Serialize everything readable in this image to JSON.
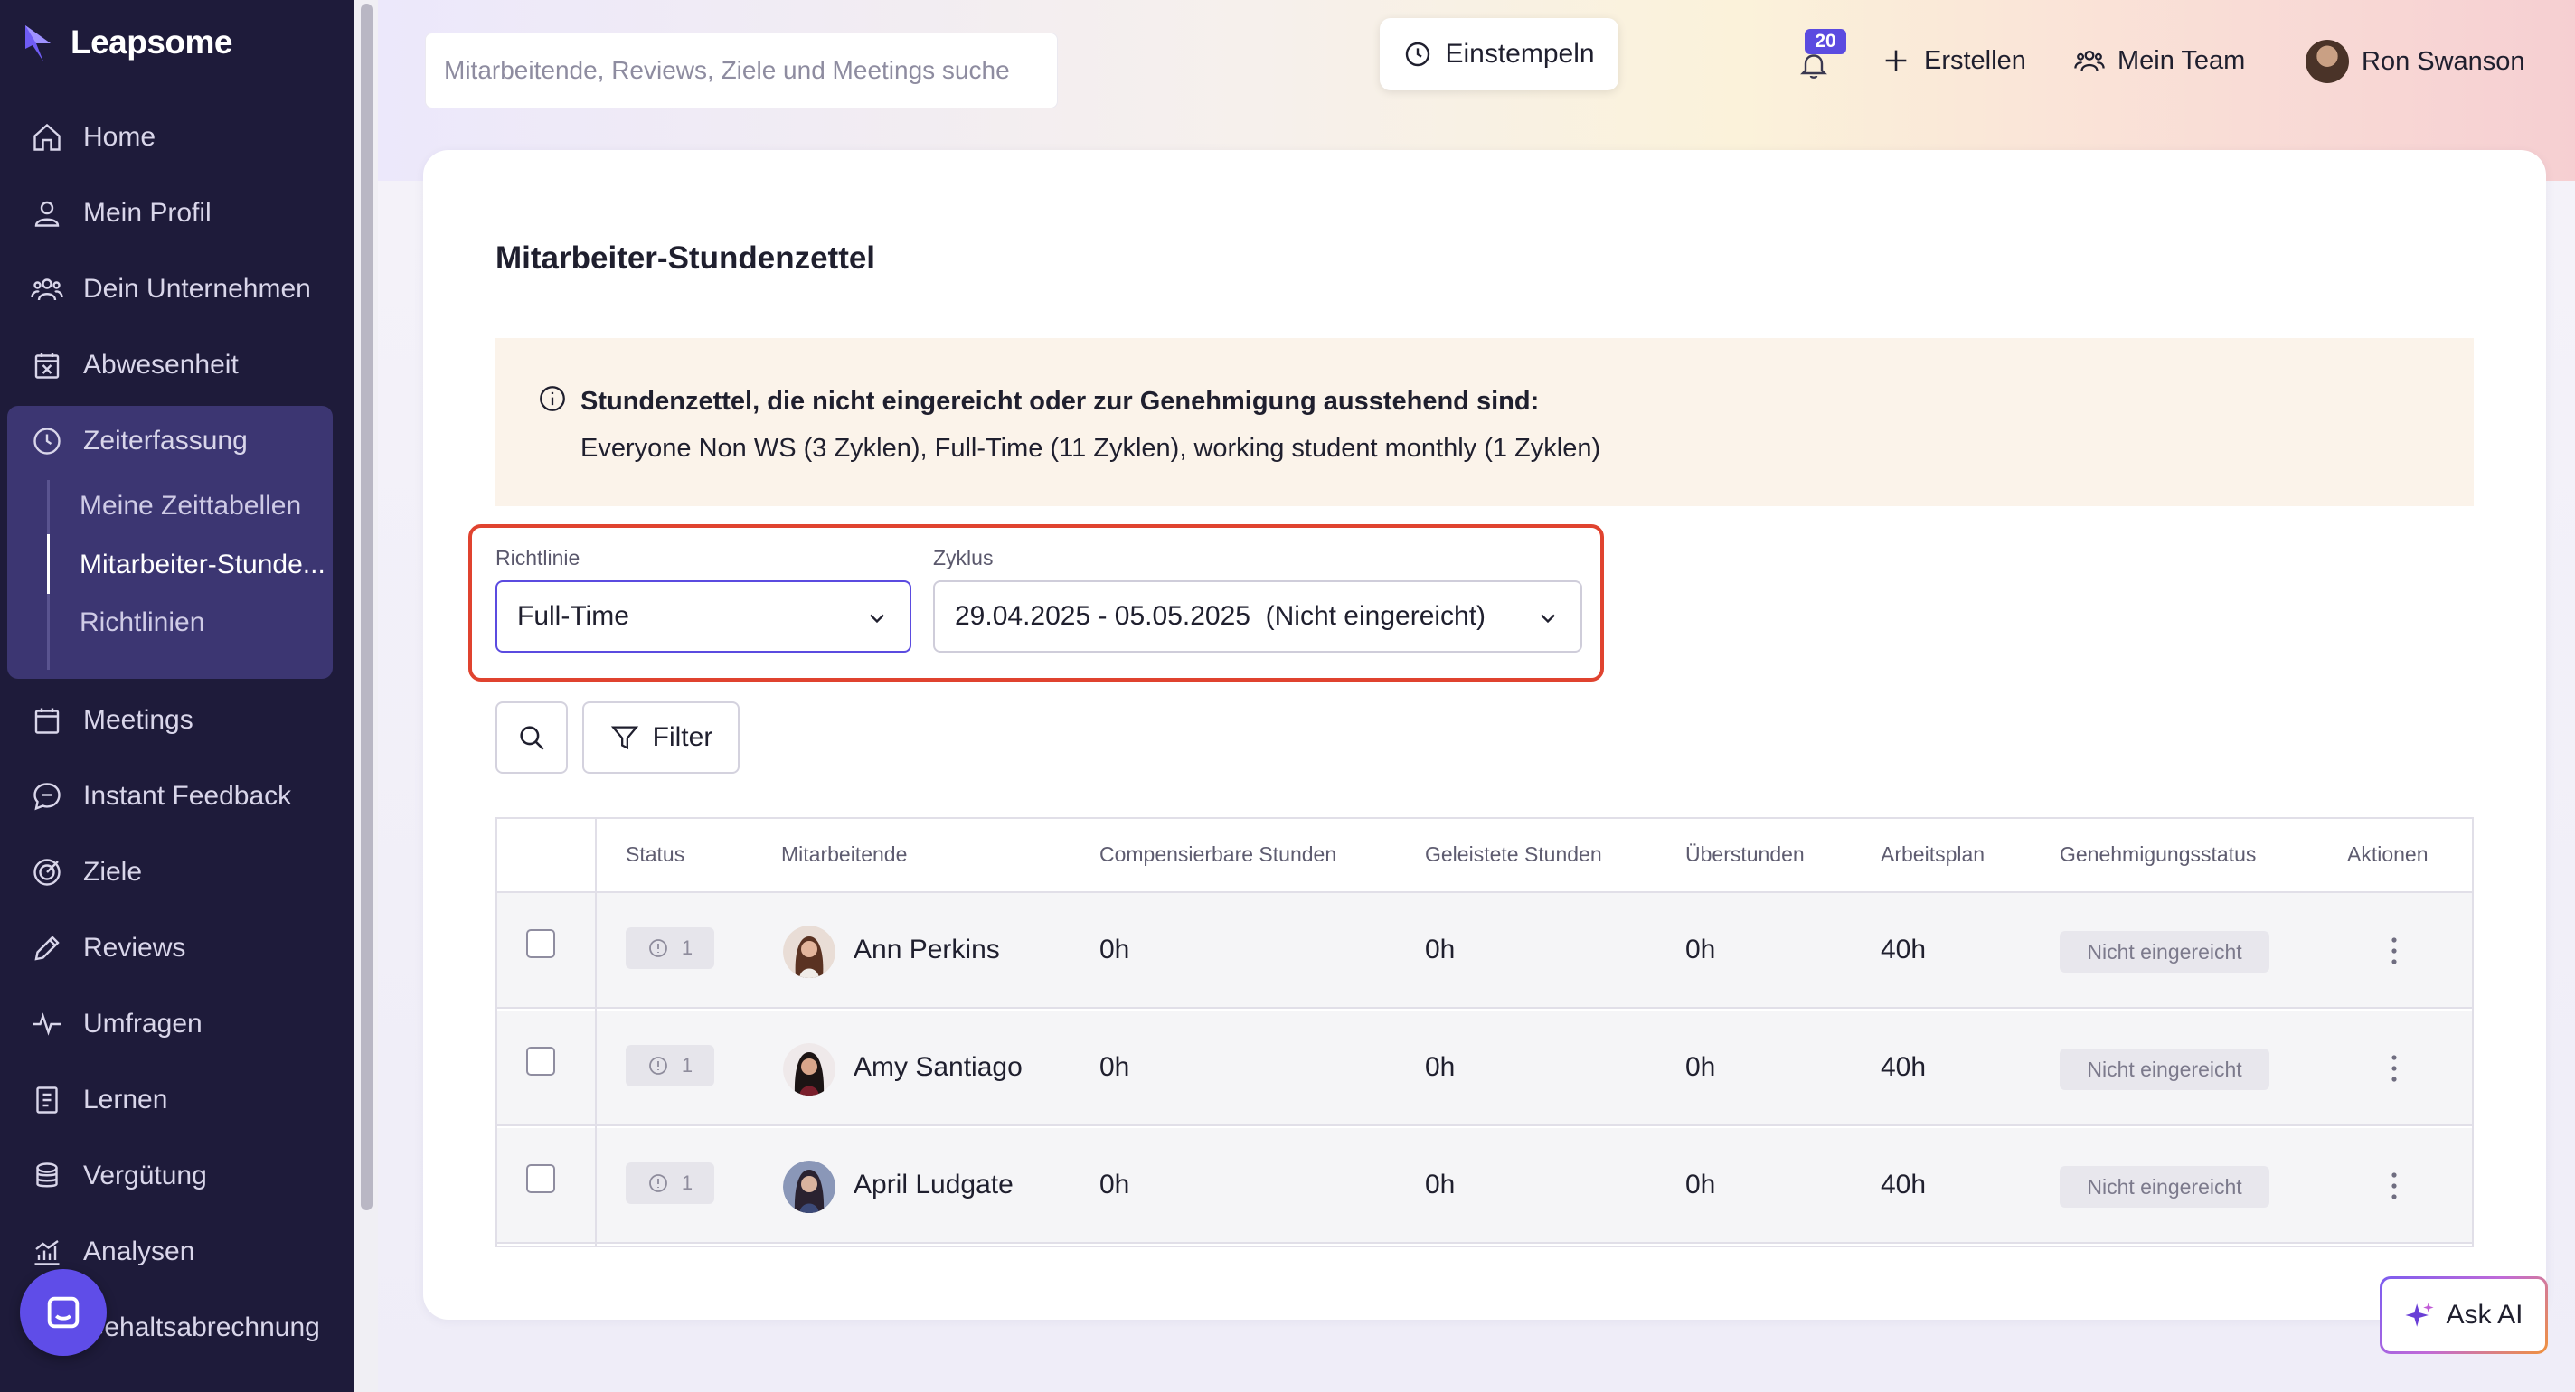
{
  "app": {
    "logo": "Leapsome"
  },
  "sidebar": {
    "items": [
      {
        "label": "Home",
        "icon": "home-icon"
      },
      {
        "label": "Mein Profil",
        "icon": "user-icon"
      },
      {
        "label": "Dein Unternehmen",
        "icon": "users-icon"
      },
      {
        "label": "Abwesenheit",
        "icon": "calendar-x-icon"
      },
      {
        "label": "Zeiterfassung",
        "icon": "clock-icon"
      },
      {
        "label": "Meetings",
        "icon": "calendar-icon"
      },
      {
        "label": "Instant Feedback",
        "icon": "chat-icon"
      },
      {
        "label": "Ziele",
        "icon": "target-icon"
      },
      {
        "label": "Reviews",
        "icon": "pencil-icon"
      },
      {
        "label": "Umfragen",
        "icon": "pulse-icon"
      },
      {
        "label": "Lernen",
        "icon": "book-icon"
      },
      {
        "label": "Vergütung",
        "icon": "coins-icon"
      },
      {
        "label": "Analysen",
        "icon": "chart-icon"
      },
      {
        "label": "Gehaltsabrechnung",
        "icon": "payroll-icon"
      }
    ],
    "sub_items": [
      {
        "label": "Meine Zeittabellen",
        "active": false
      },
      {
        "label": "Mitarbeiter-Stunde...",
        "active": true
      },
      {
        "label": "Richtlinien",
        "active": false
      }
    ]
  },
  "topbar": {
    "search_placeholder": "Mitarbeitende, Reviews, Ziele und Meetings suche",
    "clock_in_label": "Einstempeln",
    "notification_count": "20",
    "create_label": "Erstellen",
    "team_label": "Mein Team",
    "user_name": "Ron Swanson"
  },
  "page": {
    "title": "Mitarbeiter-Stundenzettel",
    "info_title": "Stundenzettel, die nicht eingereicht oder zur Genehmigung ausstehend sind:",
    "info_text": "Everyone Non WS (3 Zyklen), Full-Time (11 Zyklen), working student monthly (1 Zyklen)",
    "policy_label": "Richtlinie",
    "policy_value": "Full-Time",
    "cycle_label": "Zyklus",
    "cycle_value": "29.04.2025 - 05.05.2025  (Nicht eingereicht)",
    "filter_label": "Filter"
  },
  "table": {
    "columns": [
      "Status",
      "Mitarbeitende",
      "Compensierbare Stunden",
      "Geleistete Stunden",
      "Überstunden",
      "Arbeitsplan",
      "Genehmigungsstatus",
      "Aktionen"
    ],
    "rows": [
      {
        "status_count": "1",
        "name": "Ann Perkins",
        "comp": "0h",
        "done": "0h",
        "overtime": "0h",
        "plan": "40h",
        "approval": "Nicht eingereicht"
      },
      {
        "status_count": "1",
        "name": "Amy Santiago",
        "comp": "0h",
        "done": "0h",
        "overtime": "0h",
        "plan": "40h",
        "approval": "Nicht eingereicht"
      },
      {
        "status_count": "1",
        "name": "April Ludgate",
        "comp": "0h",
        "done": "0h",
        "overtime": "0h",
        "plan": "40h",
        "approval": "Nicht eingereicht"
      }
    ]
  },
  "ask_ai_label": "Ask AI",
  "colors": {
    "sidebar_bg": "#1e1b3a",
    "sidebar_active_bg": "#3c3672",
    "accent": "#5b4be0",
    "highlight_border": "#e0432f",
    "info_bg": "#fbf3ea"
  }
}
